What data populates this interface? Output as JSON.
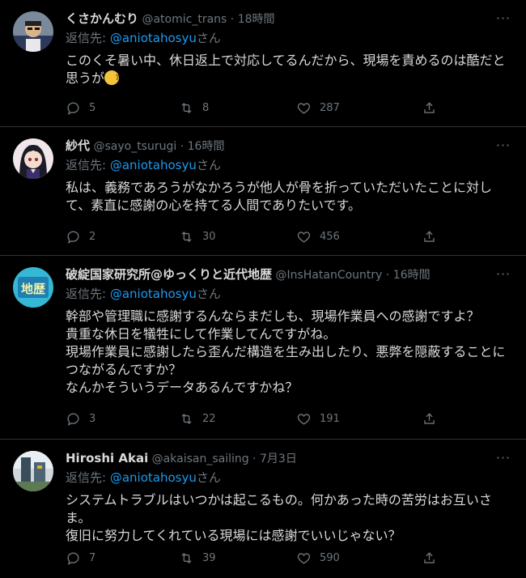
{
  "tweets": [
    {
      "name": "くさかんむり",
      "handle": "@atomic_trans",
      "time": "18時間",
      "reply_prefix": "返信先: ",
      "reply_to": "@aniotahosyu",
      "reply_suffix": "さん",
      "text": "このくそ暑い中、休日返上で対応してるんだから、現場を責めるのは酷だと思うが",
      "emoji": "thinking-face",
      "replies": "5",
      "retweets": "8",
      "likes": "287"
    },
    {
      "name": "紗代",
      "handle": "@sayo_tsurugi",
      "time": "16時間",
      "reply_prefix": "返信先: ",
      "reply_to": "@aniotahosyu",
      "reply_suffix": "さん",
      "text": "私は、義務であろうがなかろうが他人が骨を折っていただいたことに対して、素直に感謝の心を持てる人間でありたいです。",
      "replies": "2",
      "retweets": "30",
      "likes": "456"
    },
    {
      "name": "破綻国家研究所@ゆっくりと近代地歴",
      "handle": "@InsHatanCountry",
      "time": "16時間",
      "reply_prefix": "返信先: ",
      "reply_to": "@aniotahosyu",
      "reply_suffix": "さん",
      "text": "幹部や管理職に感謝するんならまだしも、現場作業員への感謝ですよ？\n貴重な休日を犠牲にして作業してんですがね。\n現場作業員に感謝したら歪んだ構造を生み出したり、悪弊を隠蔽することにつながるんですか？\nなんかそういうデータあるんですかね？",
      "avatar_text": "地歴",
      "replies": "3",
      "retweets": "22",
      "likes": "191"
    },
    {
      "name": "Hiroshi Akai",
      "handle": "@akaisan_sailing",
      "time": "7月3日",
      "reply_prefix": "返信先: ",
      "reply_to": "@aniotahosyu",
      "reply_suffix": "さん",
      "text": "システムトラブルはいつかは起こるもの。何かあった時の苦労はお互いさま。\n復旧に努力してくれている現場には感謝でいいじゃない？",
      "replies": "7",
      "retweets": "39",
      "likes": "590"
    }
  ],
  "separator": " · ",
  "more_label": "···"
}
